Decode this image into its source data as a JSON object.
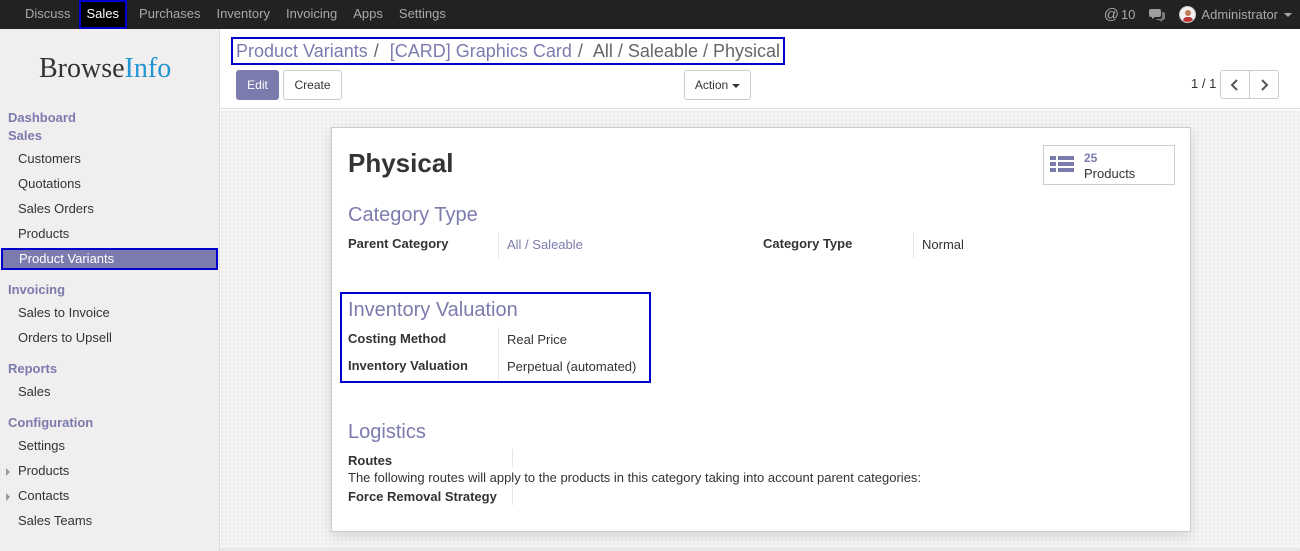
{
  "topbar": {
    "menu": [
      "Discuss",
      "Sales",
      "Purchases",
      "Inventory",
      "Invoicing",
      "Apps",
      "Settings"
    ],
    "active": "Sales",
    "mentions": "10",
    "user": "Administrator"
  },
  "logo": {
    "part1": "Browse",
    "part2": "Info"
  },
  "sidebar": {
    "dashboard": "Dashboard",
    "sales": "Sales",
    "sales_items": [
      "Customers",
      "Quotations",
      "Sales Orders",
      "Products",
      "Product Variants"
    ],
    "invoicing": "Invoicing",
    "invoicing_items": [
      "Sales to Invoice",
      "Orders to Upsell"
    ],
    "reports": "Reports",
    "reports_items": [
      "Sales"
    ],
    "configuration": "Configuration",
    "configuration_items": [
      "Settings",
      "Products",
      "Contacts",
      "Sales Teams"
    ]
  },
  "breadcrumb": {
    "item1": "Product Variants",
    "item2": "[CARD] Graphics Card",
    "current": "All / Saleable / Physical",
    "sep": "/"
  },
  "buttons": {
    "edit": "Edit",
    "create": "Create",
    "action": "Action"
  },
  "pager": {
    "value": "1 / 1"
  },
  "record": {
    "title": "Physical",
    "stat_count": "25",
    "stat_label": "Products",
    "category_type_section": "Category Type",
    "parent_category_label": "Parent Category",
    "parent_category_value": "All / Saleable",
    "category_type_label": "Category Type",
    "category_type_value": "Normal",
    "inventory_section": "Inventory Valuation",
    "costing_method_label": "Costing Method",
    "costing_method_value": "Real Price",
    "inventory_valuation_label": "Inventory Valuation",
    "inventory_valuation_value": "Perpetual (automated)",
    "logistics_section": "Logistics",
    "routes_label": "Routes",
    "routes_note": "The following routes will apply to the products in this category taking into account parent categories:",
    "removal_label": "Force Removal Strategy"
  },
  "colors": {
    "accent": "#7c7bad",
    "highlight": "#0000cc",
    "topbar": "#222222"
  }
}
